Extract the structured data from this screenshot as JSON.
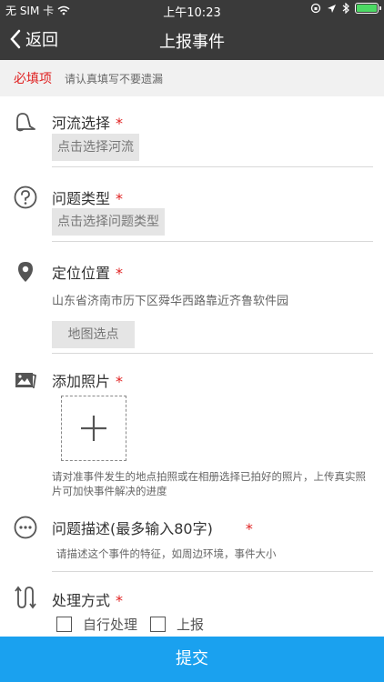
{
  "status_bar": {
    "carrier": "无 SIM 卡",
    "time": "上午10:23"
  },
  "nav": {
    "back_label": "返回",
    "title": "上报事件"
  },
  "banner": {
    "required_label": "必填项",
    "hint": "请认真填写不要遗漏"
  },
  "river": {
    "label": "河流选择",
    "required_mark": "*",
    "picker": "点击选择河流"
  },
  "problem_type": {
    "label": "问题类型",
    "required_mark": "*",
    "picker": "点击选择问题类型"
  },
  "location": {
    "label": "定位位置",
    "required_mark": "*",
    "address": "山东省济南市历下区舜华西路靠近齐鲁软件园",
    "map_button": "地图选点"
  },
  "photo": {
    "label": "添加照片",
    "required_mark": "*",
    "hint": "请对准事件发生的地点拍照或在相册选择已拍好的照片，上传真实照片可加快事件解决的进度"
  },
  "description": {
    "label": "问题描述(最多输入80字)",
    "required_mark": "*",
    "placeholder": "请描述这个事件的特征，如周边环境，事件大小"
  },
  "handling": {
    "label": "处理方式",
    "required_mark": "*",
    "options": [
      "自行处理",
      "上报"
    ]
  },
  "submit_label": "提交",
  "colors": {
    "header_bg": "#3a3a3a",
    "required_red": "#e02020",
    "submit_blue": "#1aa1ef",
    "battery_green": "#4cd964"
  }
}
